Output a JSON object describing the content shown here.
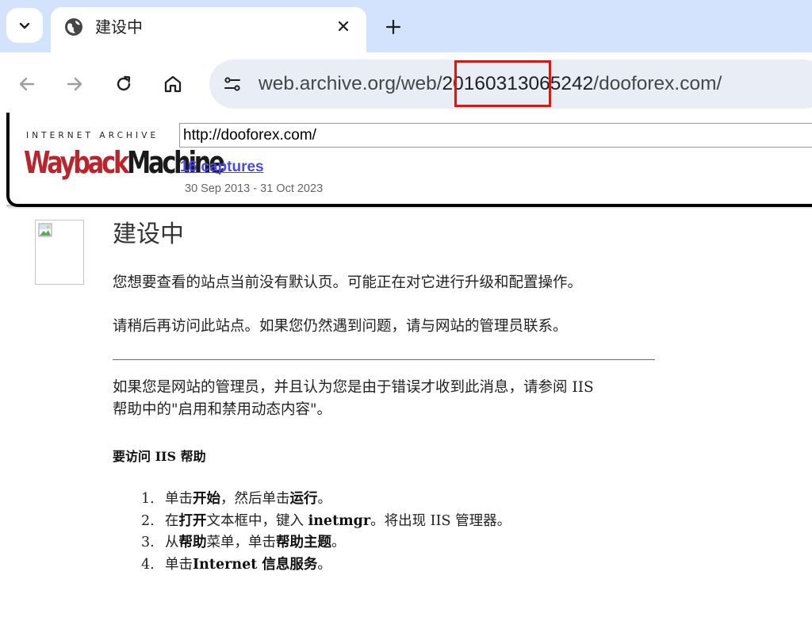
{
  "browser": {
    "tab": {
      "title": "建设中"
    },
    "address_bar": {
      "url_prefix": "web.archive.org/web/",
      "url_timestamp": "20160313065242",
      "url_suffix": "/dooforex.com/"
    }
  },
  "wayback": {
    "ia_label": "INTERNET ARCHIVE",
    "logo_part1": "Wayback",
    "logo_part2": "Machine",
    "url_input_value": "http://dooforex.com/",
    "captures_link": "16 captures",
    "captures_range": "30 Sep 2013 - 31 Oct 2023"
  },
  "page": {
    "title": "建设中",
    "para1": "您想要查看的站点当前没有默认页。可能正在对它进行升级和配置操作。",
    "para2": "请稍后再访问此站点。如果您仍然遇到问题，请与网站的管理员联系。",
    "para3_line1": "如果您是网站的管理员，并且认为您是由于错误才收到此消息，请参阅 IIS",
    "para3_line2": "帮助中的\"启用和禁用动态内容\"。",
    "help_heading": "要访问 IIS 帮助",
    "steps": [
      {
        "num": "1.",
        "a": "单击",
        "b": "开始",
        "c": "，然后单击",
        "d": "运行",
        "e": "。"
      },
      {
        "num": "2.",
        "a": "在",
        "b": "打开",
        "c": "文本框中，键入 ",
        "d": "inetmgr",
        "e": "。将出现 IIS 管理器。"
      },
      {
        "num": "3.",
        "a": "从",
        "b": "帮助",
        "c": "菜单，单击",
        "d": "帮助主题",
        "e": "。"
      },
      {
        "num": "4.",
        "a": "单击",
        "b": "Internet 信息服务",
        "c": "。",
        "d": "",
        "e": ""
      }
    ]
  }
}
